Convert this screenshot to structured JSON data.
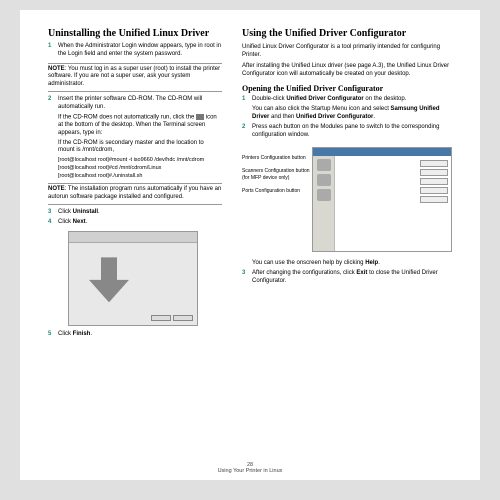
{
  "left": {
    "h1": "Uninstalling the Unified Linux Driver",
    "step1": "When the Administrator Login window appears, type in root in the Login field and enter the system password.",
    "note1_label": "NOTE",
    "note1": ": You must log in as a super user (root) to install the printer software. If you are not a super user, ask your system administrator.",
    "step2": "Insert the printer software CD-ROM. The CD-ROM will automatically run.",
    "ind1": "If the CD-ROM does not automatically run, click the ",
    "ind1b": " icon at the bottom of the desktop. When the Terminal screen appears, type in:",
    "ind2": "If the CD-ROM is secondary master and the location to mount is /mnt/cdrom,",
    "cmd1": "[root@localhost root]#mount -t iso9660 /dev/hdc /mnt/cdrom",
    "cmd2": "[root@localhost root]#cd /mnt/cdrom/Linux",
    "cmd3": "[root@localhost root]#./uninstall.sh",
    "note2_label": "NOTE",
    "note2": ": The installation program runs automatically if you have an autorun software package installed and configured.",
    "step3a": "Click ",
    "step3b": "Uninstall",
    "step4a": "Click ",
    "step4b": "Next",
    "step5a": "Click ",
    "step5b": "Finish"
  },
  "right": {
    "h1": "Using the Unified Driver Configurator",
    "p1": "Unified Linux Driver Configurator is a tool primarily intended for configuring Printer.",
    "p2": "After installing the Unified Linux driver (see page A.3), the Unified Linux Driver Configurator icon will automatically be created on your desktop.",
    "h2": "Opening the Unified Driver Configurator",
    "step1a": "Double-click ",
    "step1b": "Unified Driver Configurator",
    "step1c": " on the desktop.",
    "ind1a": "You can also click the Startup Menu icon and select ",
    "ind1b": "Samsung Unified Driver",
    "ind1c": " and then ",
    "ind1d": "Unified Driver Configurator",
    "step2": "Press each button on the Modules pane to switch to the corresponding configuration window.",
    "lbl1": "Printers Configuration button",
    "lbl2": "Scanners Configuration button (for MFP device only)",
    "lbl3": "Ports Configuration button",
    "p3a": "You can use the onscreen help by clicking ",
    "p3b": "Help",
    "step3a": "After changing the configurations, click ",
    "step3b": "Exit",
    "step3c": " to close the Unified Driver Configurator."
  },
  "footer": {
    "page": "28",
    "title": "Using Your Printer in Linux"
  }
}
